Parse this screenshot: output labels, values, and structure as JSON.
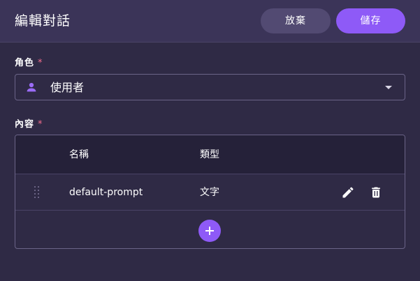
{
  "dialog": {
    "title": "編輯對話",
    "discard_label": "放棄",
    "save_label": "儲存"
  },
  "role_field": {
    "label": "角色",
    "required_mark": "*",
    "value": "使用者",
    "icon": "person-icon"
  },
  "content_field": {
    "label": "內容",
    "required_mark": "*",
    "columns": [
      "名稱",
      "類型"
    ],
    "rows": [
      {
        "name": "default-prompt",
        "type": "文字"
      }
    ]
  },
  "colors": {
    "accent": "#8e5af7",
    "required": "#f06c8c",
    "background": "#2f2a45",
    "header": "#3b3458"
  }
}
